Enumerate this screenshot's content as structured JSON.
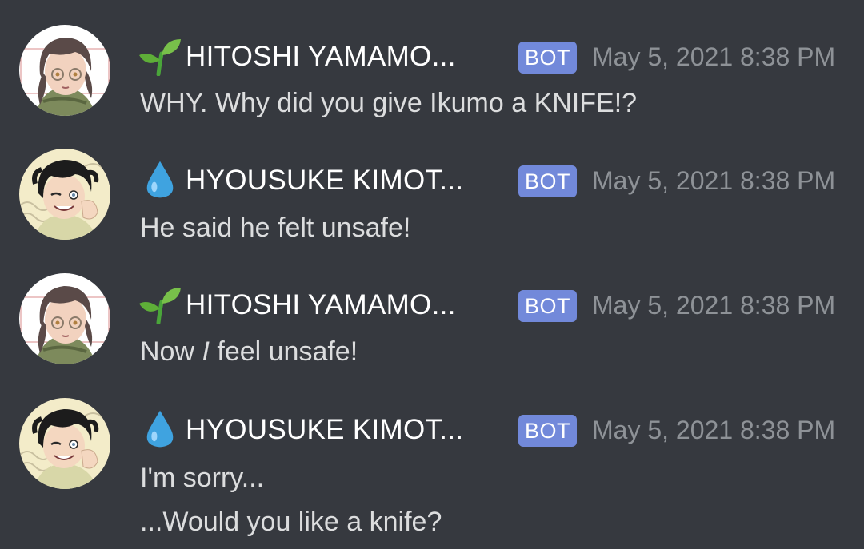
{
  "colors": {
    "background": "#36393f",
    "username": "#ffffff",
    "message_text": "#dcddde",
    "timestamp": "#8e9297",
    "bot_badge": "#7289da"
  },
  "messages": [
    {
      "avatar": "hitoshi-avatar",
      "emoji": "seedling-icon",
      "username": "HITOSHI YAMAMO...",
      "badge": "BOT",
      "timestamp": "May 5, 2021 8:38 PM",
      "lines": [
        "WHY. Why did you give Ikumo a KNIFE!?"
      ]
    },
    {
      "avatar": "hyousuke-avatar",
      "emoji": "droplet-icon",
      "username": "HYOUSUKE KIMOT...",
      "badge": "BOT",
      "timestamp": "May 5, 2021 8:38 PM",
      "lines": [
        "He said he felt unsafe!"
      ]
    },
    {
      "avatar": "hitoshi-avatar",
      "emoji": "seedling-icon",
      "username": "HITOSHI YAMAMO...",
      "badge": "BOT",
      "timestamp": "May 5, 2021 8:38 PM",
      "lines": [],
      "line_parts": {
        "before": "Now ",
        "emphasis": "I",
        "after": " feel unsafe!"
      }
    },
    {
      "avatar": "hyousuke-avatar",
      "emoji": "droplet-icon",
      "username": "HYOUSUKE KIMOT...",
      "badge": "BOT",
      "timestamp": "May 5, 2021 8:38 PM",
      "lines": [
        "I'm sorry...",
        "...Would you like a knife?"
      ]
    }
  ]
}
